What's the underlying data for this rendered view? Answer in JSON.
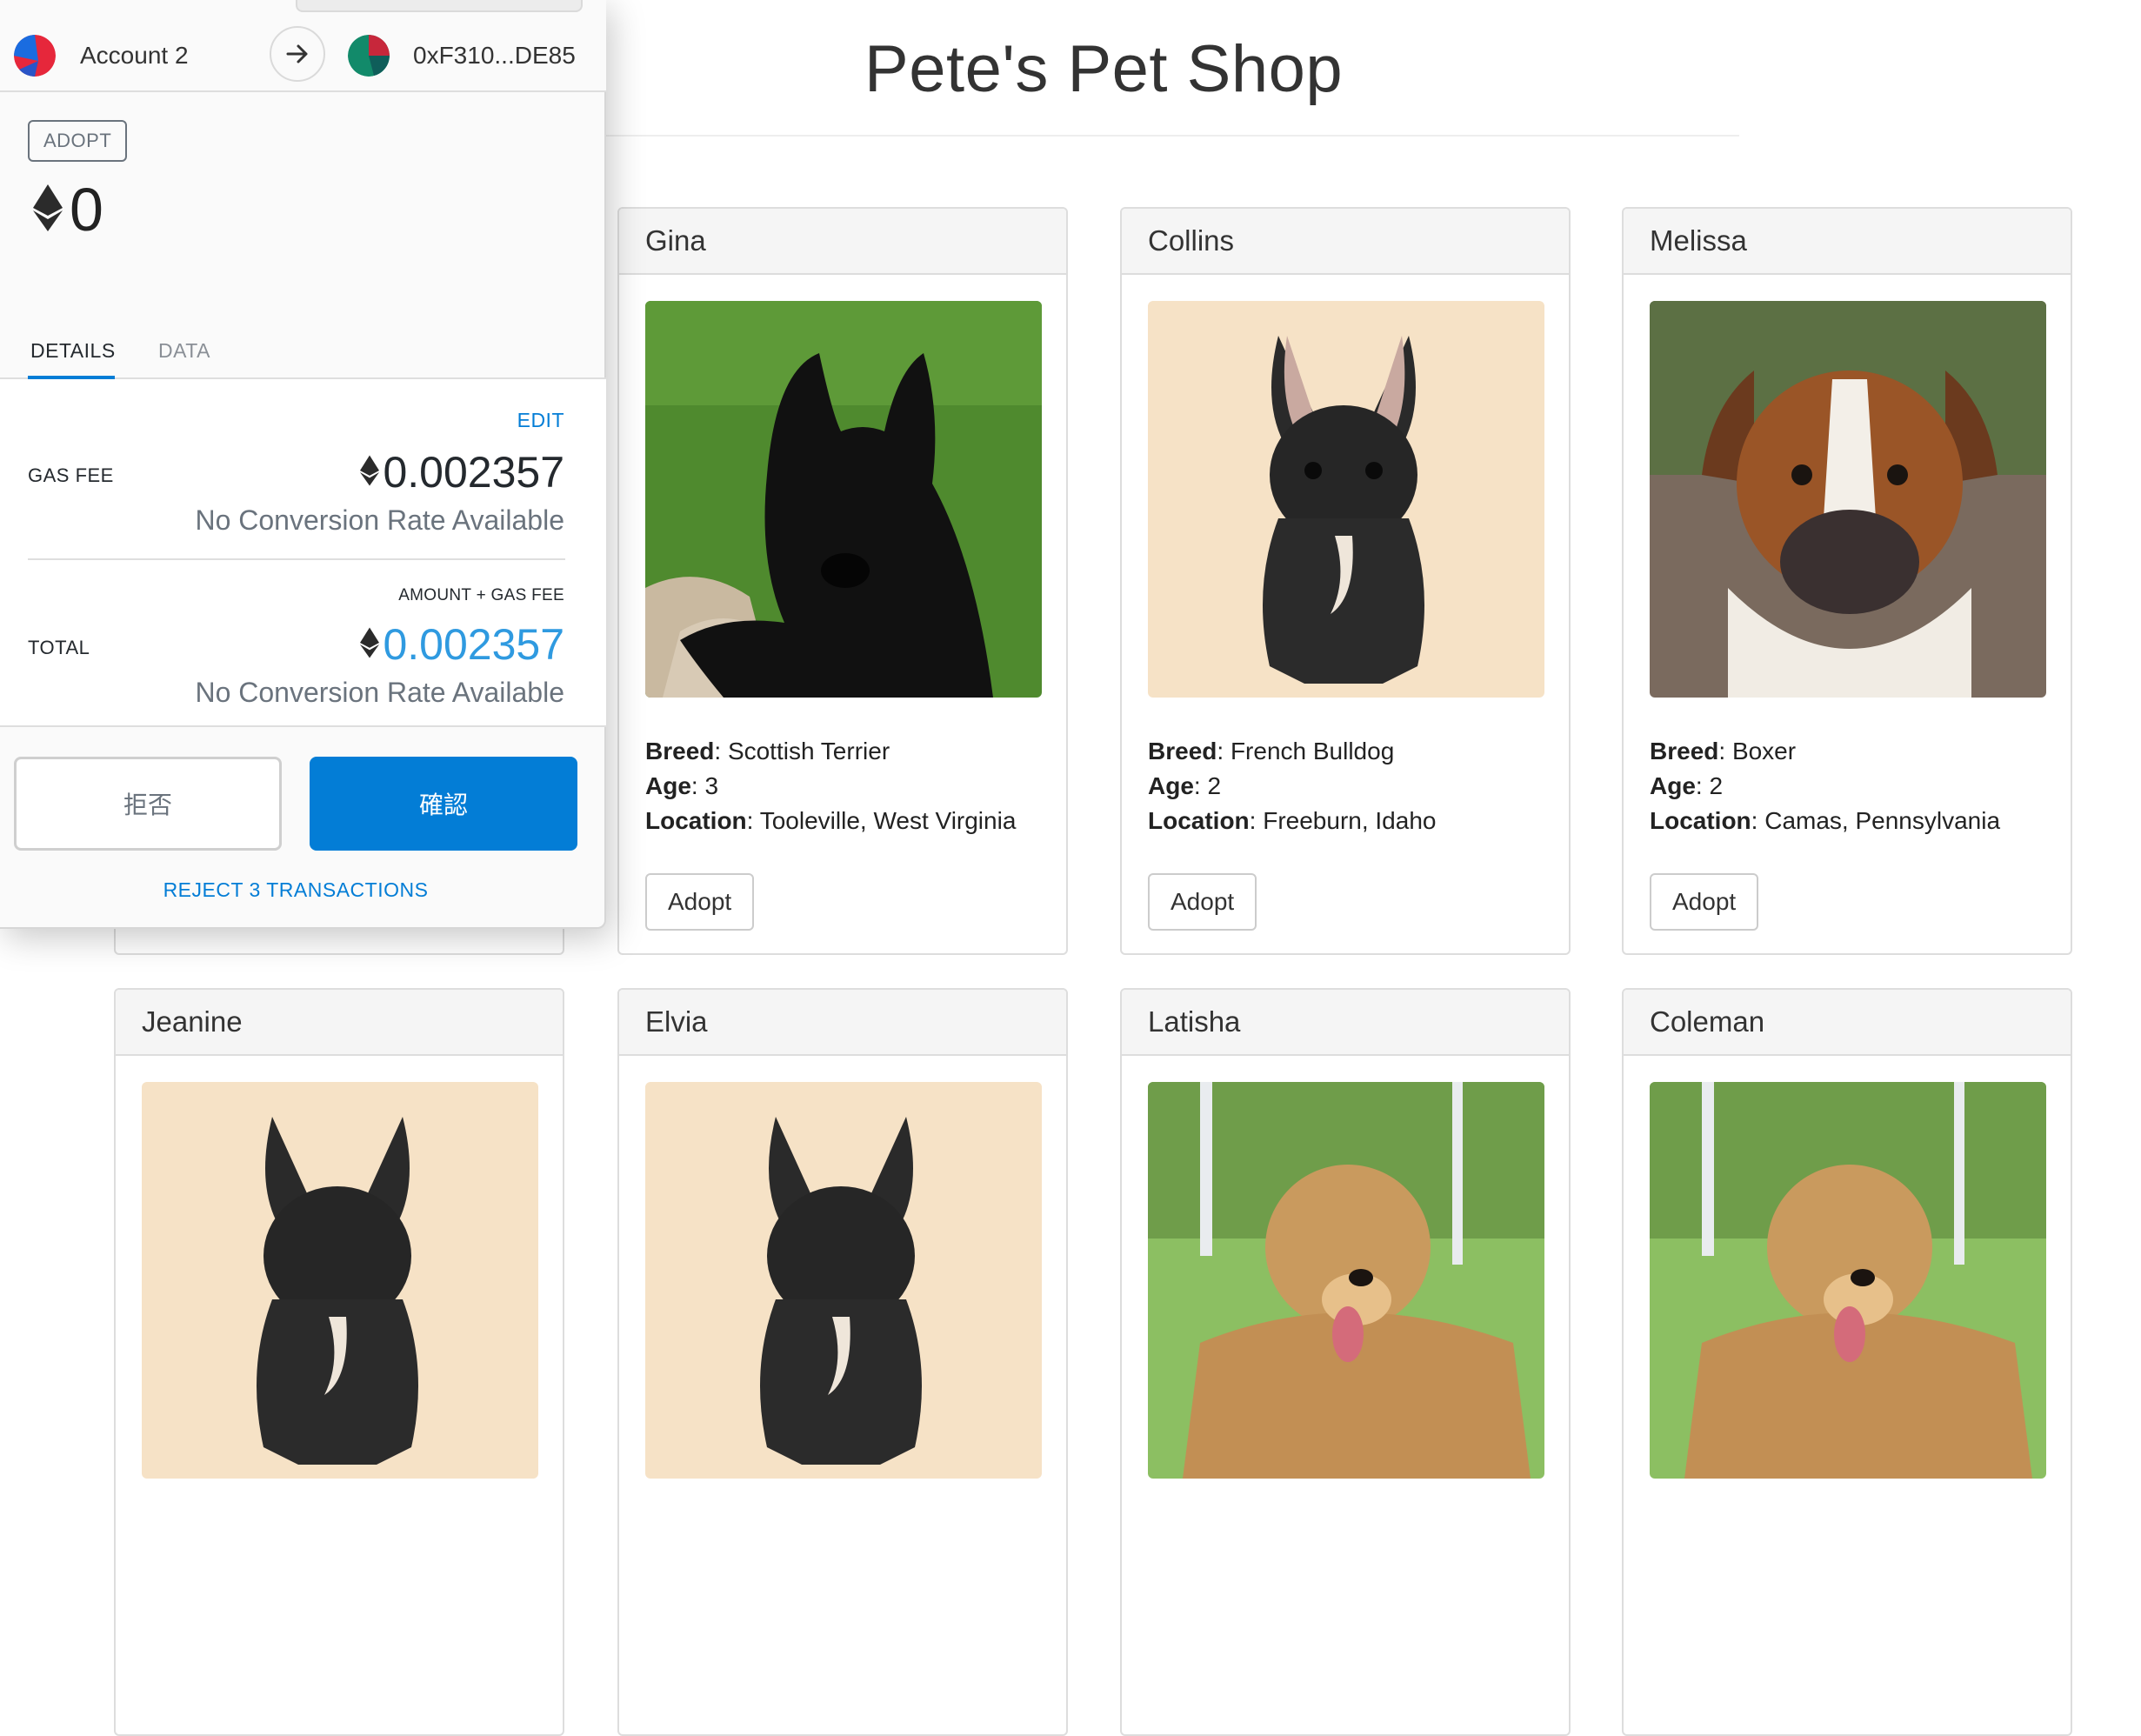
{
  "shop": {
    "title": "Pete's Pet Shop",
    "adopt_label": "Adopt",
    "breed_label": "Breed",
    "age_label": "Age",
    "location_label": "Location",
    "pets": [
      {
        "name": "Gina",
        "breed": "Scottish Terrier",
        "age": "3",
        "location": "Tooleville, West Virginia",
        "photo": "scottish-terrier-photo"
      },
      {
        "name": "Collins",
        "breed": "French Bulldog",
        "age": "2",
        "location": "Freeburn, Idaho",
        "photo": "french-bulldog-photo"
      },
      {
        "name": "Melissa",
        "breed": "Boxer",
        "age": "2",
        "location": "Camas, Pennsylvania",
        "photo": "boxer-photo"
      },
      {
        "name": "Jeanine",
        "photo": "french-bulldog-photo"
      },
      {
        "name": "Elvia",
        "photo": "french-bulldog-photo"
      },
      {
        "name": "Latisha",
        "photo": "golden-retriever-photo"
      },
      {
        "name": "Coleman",
        "photo": "golden-retriever-photo"
      }
    ]
  },
  "metamask": {
    "from_account": "Account 2",
    "to_address": "0xF310...DE85",
    "method": "ADOPT",
    "amount": "0",
    "tabs": [
      "DETAILS",
      "DATA"
    ],
    "active_tab": "DETAILS",
    "edit_label": "EDIT",
    "gas_fee_label": "GAS FEE",
    "gas_fee_value": "0.002357",
    "gas_fee_conversion": "No Conversion Rate Available",
    "total_heading": "AMOUNT + GAS FEE",
    "total_label": "TOTAL",
    "total_value": "0.002357",
    "total_conversion": "No Conversion Rate Available",
    "reject_label": "拒否",
    "confirm_label": "確認",
    "reject_all_label": "REJECT 3 TRANSACTIONS",
    "colors": {
      "accent": "#037dd6",
      "total_value": "#2f9ae0",
      "muted": "#6a737d"
    },
    "icons": [
      "account-identicon",
      "arrow-right-icon",
      "address-identicon",
      "ethereum-icon"
    ]
  }
}
